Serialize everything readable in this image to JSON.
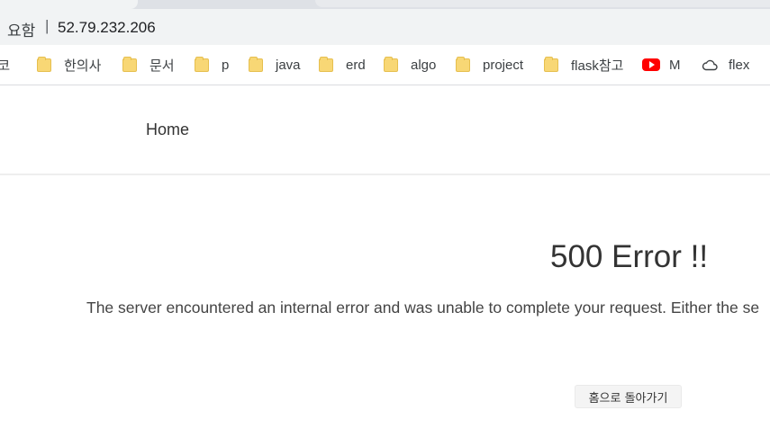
{
  "browser": {
    "address_bar": {
      "security_text": "요함",
      "separator": "|",
      "url": "52.79.232.206"
    },
    "bookmarks": [
      {
        "label": "l코",
        "icon": "none"
      },
      {
        "label": "한의사",
        "icon": "folder-icon"
      },
      {
        "label": "문서",
        "icon": "folder-icon"
      },
      {
        "label": "p",
        "icon": "folder-icon"
      },
      {
        "label": "java",
        "icon": "folder-icon"
      },
      {
        "label": "erd",
        "icon": "folder-icon"
      },
      {
        "label": "algo",
        "icon": "folder-icon"
      },
      {
        "label": "project",
        "icon": "folder-icon"
      },
      {
        "label": "flask참고",
        "icon": "folder-icon"
      },
      {
        "label": "M",
        "icon": "youtube-icon"
      },
      {
        "label": "flex",
        "icon": "cloud-icon"
      }
    ]
  },
  "page": {
    "nav": {
      "home_label": "Home"
    },
    "error": {
      "title": "500 Error !!",
      "message": "The server encountered an internal error and was unable to complete your request. Either the se",
      "back_button_label": "홈으로 돌아가기"
    }
  }
}
